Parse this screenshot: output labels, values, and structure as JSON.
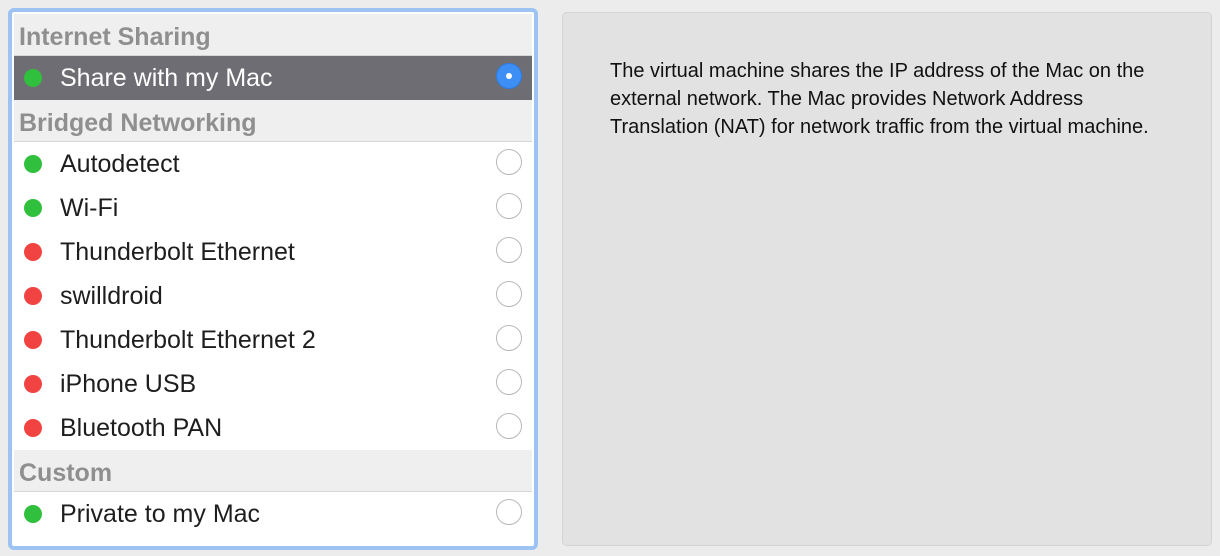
{
  "colors": {
    "selection_border": "#9dc3f2",
    "selected_row": "#6d6d73",
    "status_connected": "#31c03e",
    "status_disconnected": "#f24343",
    "radio_checked": "#3d8ff5"
  },
  "sections": [
    {
      "title": "Internet Sharing",
      "items": [
        {
          "label": "Share with my Mac",
          "status": "connected",
          "selected": true
        }
      ]
    },
    {
      "title": "Bridged Networking",
      "items": [
        {
          "label": "Autodetect",
          "status": "connected",
          "selected": false
        },
        {
          "label": "Wi-Fi",
          "status": "connected",
          "selected": false
        },
        {
          "label": "Thunderbolt Ethernet",
          "status": "disconnected",
          "selected": false
        },
        {
          "label": "swilldroid",
          "status": "disconnected",
          "selected": false
        },
        {
          "label": "Thunderbolt Ethernet 2",
          "status": "disconnected",
          "selected": false
        },
        {
          "label": "iPhone USB",
          "status": "disconnected",
          "selected": false
        },
        {
          "label": "Bluetooth PAN",
          "status": "disconnected",
          "selected": false
        }
      ]
    },
    {
      "title": "Custom",
      "items": [
        {
          "label": "Private to my Mac",
          "status": "connected",
          "selected": false
        }
      ]
    }
  ],
  "description": "The virtual machine shares the IP address of the Mac on the external network. The Mac provides Network Address Translation (NAT) for network traffic from the virtual machine."
}
